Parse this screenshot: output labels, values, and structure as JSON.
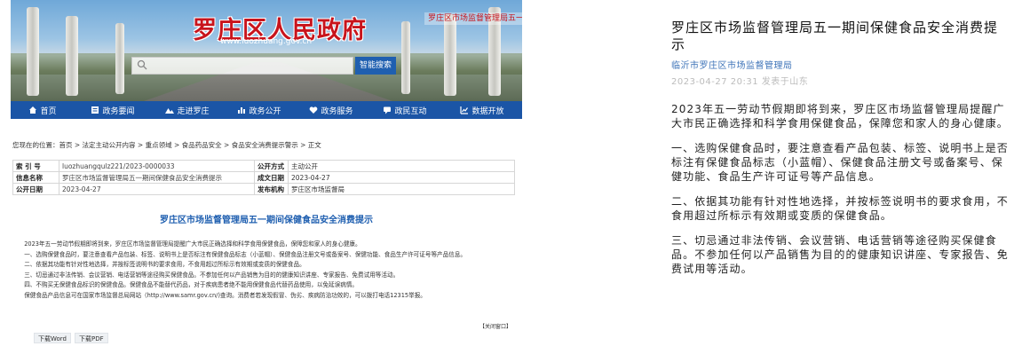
{
  "site": {
    "title": "罗庄区人民政府",
    "url": "www.luozhuang.gov.cn",
    "banner_right": "罗庄区市场监督管理局五一",
    "search_button": "智能搜索"
  },
  "nav": [
    {
      "label": "首页",
      "icon": "home-icon"
    },
    {
      "label": "政务要闻",
      "icon": "news-icon"
    },
    {
      "label": "走进罗庄",
      "icon": "landscape-icon"
    },
    {
      "label": "政务公开",
      "icon": "chart-icon"
    },
    {
      "label": "政务服务",
      "icon": "heart-icon"
    },
    {
      "label": "政民互动",
      "icon": "chat-icon"
    },
    {
      "label": "数据开放",
      "icon": "data-icon"
    }
  ],
  "breadcrumb": "您现在的位置：首页 > 法定主动公开内容 > 重点领域 > 食品药品安全 > 食品安全消费提示警示 > 正文",
  "meta": {
    "index_label": "索 引 号",
    "index_value": "luozhuangqulz221/2023-0000033",
    "method_label": "公开方式",
    "method_value": "主动公开",
    "name_label": "信息名称",
    "name_value": "罗庄区市场监督管理局五一期间保健食品安全消费提示",
    "created_label": "成文日期",
    "created_value": "2023-04-27",
    "public_label": "公开日期",
    "public_value": "2023-04-27",
    "org_label": "发布机构",
    "org_value": "罗庄区市场监督局"
  },
  "article_title": "罗庄区市场监督管理局五一期间保健食品安全消费提示",
  "article_paragraphs": [
    "2023年五一劳动节假期即将到来，罗庄区市场监督管理局提醒广大市民正确选择和科学食用保健食品，保障您和家人的身心健康。",
    "一、选购保健食品时，要注意查看产品包装、标签、说明书上是否标注有保健食品标志（小蓝帽）、保健食品注册文号或备案号、保健功能、食品生产许可证号等产品信息。",
    "二、依据其功能有针对性地选择，并按标签说明书的要求食用，不食用超过所标示有效期或变质的保健食品。",
    "三、切忌通过非法传销、会议营销、电话营销等途径购买保健食品。不参加任何以产品销售为目的的健康知识讲座、专家报告、免费试用等活动。",
    "四、不购买无保健食品标识的保健食品。保健食品不能替代药品，对于疾病患者绝不能用保健食品代替药品使用，以免延误病情。",
    "保健食品产品信息可在国家市场监督总局网站（http://www.samr.gov.cn/)查询。消费者若发现假冒、伪劣、疾病防治功效的，可以拨打电话12315举报。"
  ],
  "print_link": "【关闭窗口】",
  "download_word": "下载Word",
  "download_pdf": "下载PDF",
  "mobile": {
    "title": "罗庄区市场监督管理局五一期间保健食品安全消费提示",
    "source": "临沂市罗庄区市场监督管理局",
    "time": "2023-04-27 20:31  发表于山东",
    "paragraphs": [
      "2023年五一劳动节假期即将到来，罗庄区市场监督管理局提醒广大市民正确选择和科学食用保健食品，保障您和家人的身心健康。",
      "一、选购保健食品时，要注意查看产品包装、标签、说明书上是否标注有保健食品标志（小蓝帽）、保健食品注册文号或备案号、保健功能、食品生产许可证号等产品信息。",
      "二、依据其功能有针对性地选择，并按标签说明书的要求食用，不食用超过所标示有效期或变质的保健食品。",
      "三、切忌通过非法传销、会议营销、电话营销等途径购买保健食品。不参加任何以产品销售为目的的健康知识讲座、专家报告、免费试用等活动。"
    ]
  },
  "colors": {
    "nav_bg": "#1b55a6",
    "site_title": "#c8141c",
    "article_title": "#1f5fb0",
    "mobile_source": "#3d73b8"
  }
}
